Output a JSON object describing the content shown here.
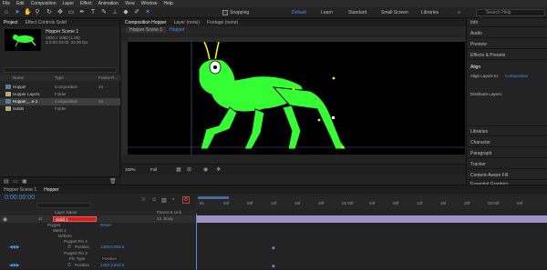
{
  "menu": [
    "File",
    "Edit",
    "Composition",
    "Layer",
    "Effect",
    "Animation",
    "View",
    "Window",
    "Help"
  ],
  "workspaces": {
    "snapping": "Snapping",
    "items": [
      "Default",
      "Learn",
      "Standard",
      "Small Screen",
      "Libraries"
    ]
  },
  "search_placeholder": "Search Help",
  "project": {
    "tab": "Project",
    "fx_tab": "Effect Controls Solid",
    "comp_name": "Hopper Scene 1",
    "comp_info1": "1920 x 1080 (1.00)",
    "comp_info2": "Δ 0:00:10:00, 24.00 fps",
    "columns": {
      "name": "Name",
      "type": "Type",
      "size": "Frame R..."
    },
    "rows": [
      {
        "name": "Hopper",
        "type": "Composition",
        "size": "24"
      },
      {
        "name": "Hopper Layers",
        "type": "Folder",
        "size": ""
      },
      {
        "name": "Hopper_...e 1",
        "type": "Composition",
        "size": "24"
      },
      {
        "name": "Solids",
        "type": "Folder",
        "size": ""
      }
    ]
  },
  "viewer": {
    "tabs": [
      "Composition Hopper",
      "Layer (none)",
      "Footage (none)"
    ],
    "crumbs": [
      "Hopper Scene 1",
      "Hopper"
    ],
    "zoom": "100%",
    "res": "Full"
  },
  "right": {
    "items": [
      "Info",
      "Audio",
      "Preview",
      "Effects & Presets",
      "Align",
      "Libraries",
      "Character",
      "Paragraph",
      "Tracker",
      "Content-Aware Fill",
      "Essential Graphics"
    ],
    "align_to_label": "Align Layers to:",
    "align_to_value": "Composition",
    "distribute": "Distribute Layers:"
  },
  "timeline": {
    "tabs": [
      "Hopper Scene 1",
      "Hopper"
    ],
    "timecode": "0:00:00:00",
    "ruler": [
      "0s",
      "04f",
      "08f",
      "12f",
      "16f",
      "20f",
      "01:00f",
      "04f",
      "08f",
      "12f",
      "16f",
      "20f",
      "02:00f",
      "04f"
    ],
    "col_headers": {
      "layer": "Layer Name",
      "parent": "Parent & Link"
    },
    "layer": {
      "num": "11",
      "name": "Solid 1",
      "parent": "12. Body"
    },
    "rows": [
      {
        "label": "Puppet",
        "indent": 1,
        "value": "Reset"
      },
      {
        "label": "Mesh 1",
        "indent": 2,
        "value": ""
      },
      {
        "label": "Deform",
        "indent": 3,
        "value": ""
      },
      {
        "label": "Puppet Pin 4",
        "indent": 4,
        "value": ""
      },
      {
        "label": "Position",
        "indent": 5,
        "value": "1389.8,993.6"
      },
      {
        "label": "Puppet Pin 3",
        "indent": 4,
        "value": ""
      },
      {
        "label": "Pin Type",
        "indent": 5,
        "value": "Position"
      },
      {
        "label": "Position",
        "indent": 5,
        "value": "1250.3,833.6"
      }
    ]
  }
}
